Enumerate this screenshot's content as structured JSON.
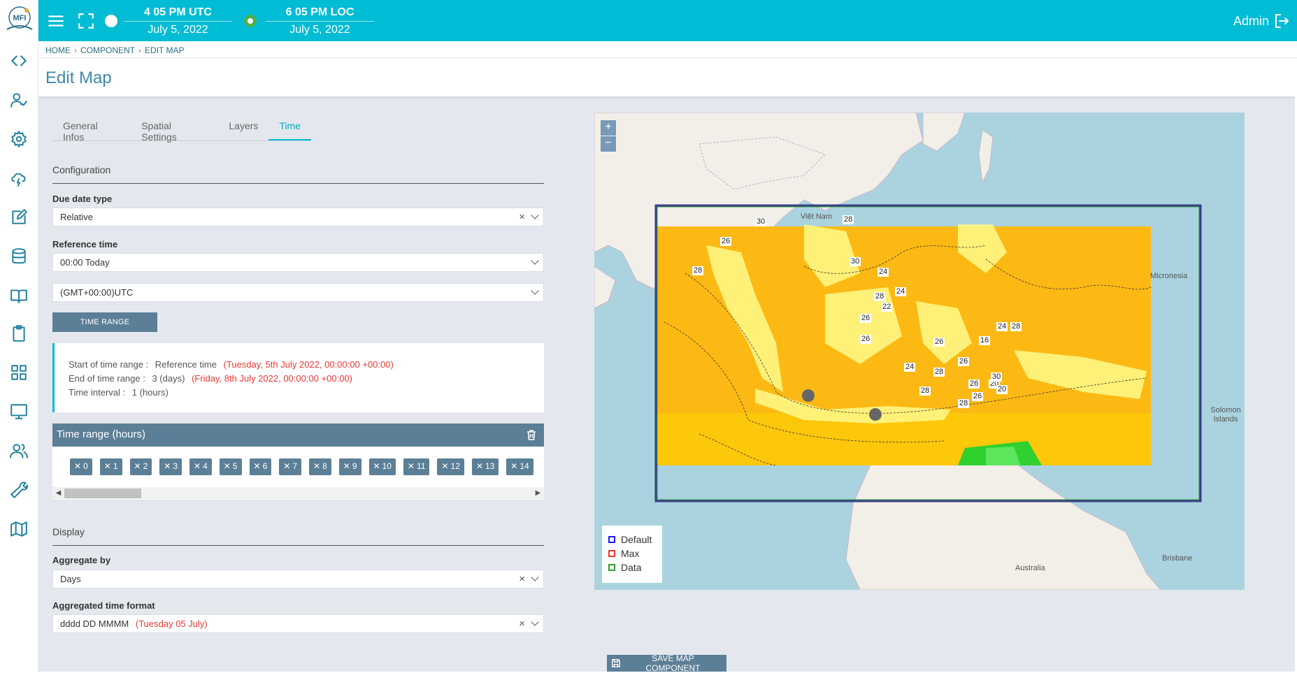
{
  "app": {
    "logo_text": "MFI"
  },
  "topbar": {
    "utc_time": "4  05 PM UTC",
    "utc_date": "July 5, 2022",
    "loc_time": "6  05 PM LOC",
    "loc_date": "July 5, 2022",
    "user": "Admin"
  },
  "breadcrumb": {
    "home": "HOME",
    "component": "COMPONENT",
    "current": "EDIT MAP"
  },
  "page": {
    "title": "Edit Map"
  },
  "tabs": [
    {
      "label": "General Infos"
    },
    {
      "label": "Spatial Settings"
    },
    {
      "label": "Layers"
    },
    {
      "label": "Time"
    }
  ],
  "configuration": {
    "title": "Configuration",
    "due_date_label": "Due date type",
    "due_date_value": "Relative",
    "reference_label": "Reference time",
    "reference_value": "00:00 Today",
    "timezone_value": "(GMT+00:00)UTC",
    "time_range_button": "TIME RANGE"
  },
  "info": {
    "start_label": "Start of time range :",
    "start_value": "Reference time",
    "start_date": "(Tuesday, 5th July 2022, 00:00:00 +00:00)",
    "end_label": "End of time range :",
    "end_value": "3 (days)",
    "end_date": "(Friday, 8th July 2022, 00:00:00 +00:00)",
    "interval_label": "Time interval :",
    "interval_value": "1 (hours)"
  },
  "time_range": {
    "title": "Time range (hours)",
    "chips": [
      "0",
      "1",
      "2",
      "3",
      "4",
      "5",
      "6",
      "7",
      "8",
      "9",
      "10",
      "11",
      "12",
      "13",
      "14"
    ]
  },
  "display": {
    "title": "Display",
    "aggregate_label": "Aggregate by",
    "aggregate_value": "Days",
    "format_label": "Aggregated time format",
    "format_value": "dddd DD MMMM",
    "format_preview": "(Tuesday 05 July)"
  },
  "map": {
    "zoom_in": "+",
    "zoom_out": "−",
    "legend": [
      {
        "label": "Default",
        "color": "#1a1aff"
      },
      {
        "label": "Max",
        "color": "#e53935"
      },
      {
        "label": "Data",
        "color": "#2e9e2e"
      }
    ],
    "labels": {
      "micronesia": "Micronesia",
      "solomon": "Solomon Islands",
      "australia": "Australia",
      "brisbane": "Brisbane",
      "vietnam": "Việt Nam"
    },
    "contour_labels": [
      "28",
      "26",
      "30",
      "28",
      "24",
      "30",
      "28",
      "24",
      "26",
      "22",
      "16",
      "24",
      "28",
      "26",
      "20",
      "24",
      "26",
      "26",
      "28",
      "20",
      "26",
      "28",
      "30",
      "26",
      "28"
    ]
  },
  "actions": {
    "save": "SAVE MAP COMPONENT"
  }
}
